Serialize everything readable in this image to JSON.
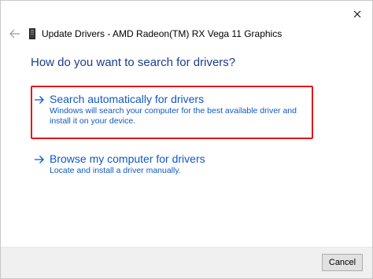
{
  "window": {
    "title": "Update Drivers - AMD Radeon(TM) RX Vega 11 Graphics",
    "close_icon": "close-icon",
    "back_icon": "back-arrow-icon",
    "device_icon": "device-icon"
  },
  "main": {
    "heading": "How do you want to search for drivers?",
    "options": [
      {
        "title": "Search automatically for drivers",
        "description": "Windows will search your computer for the best available driver and install it on your device.",
        "icon": "arrow-right-icon",
        "highlighted": true
      },
      {
        "title": "Browse my computer for drivers",
        "description": "Locate and install a driver manually.",
        "icon": "arrow-right-icon",
        "highlighted": false
      }
    ]
  },
  "footer": {
    "cancel_label": "Cancel"
  },
  "colors": {
    "link_blue": "#0f58c4",
    "heading_blue": "#1a3d8f",
    "highlight_red": "#e3171c",
    "footer_bg": "#f0f0f0"
  }
}
